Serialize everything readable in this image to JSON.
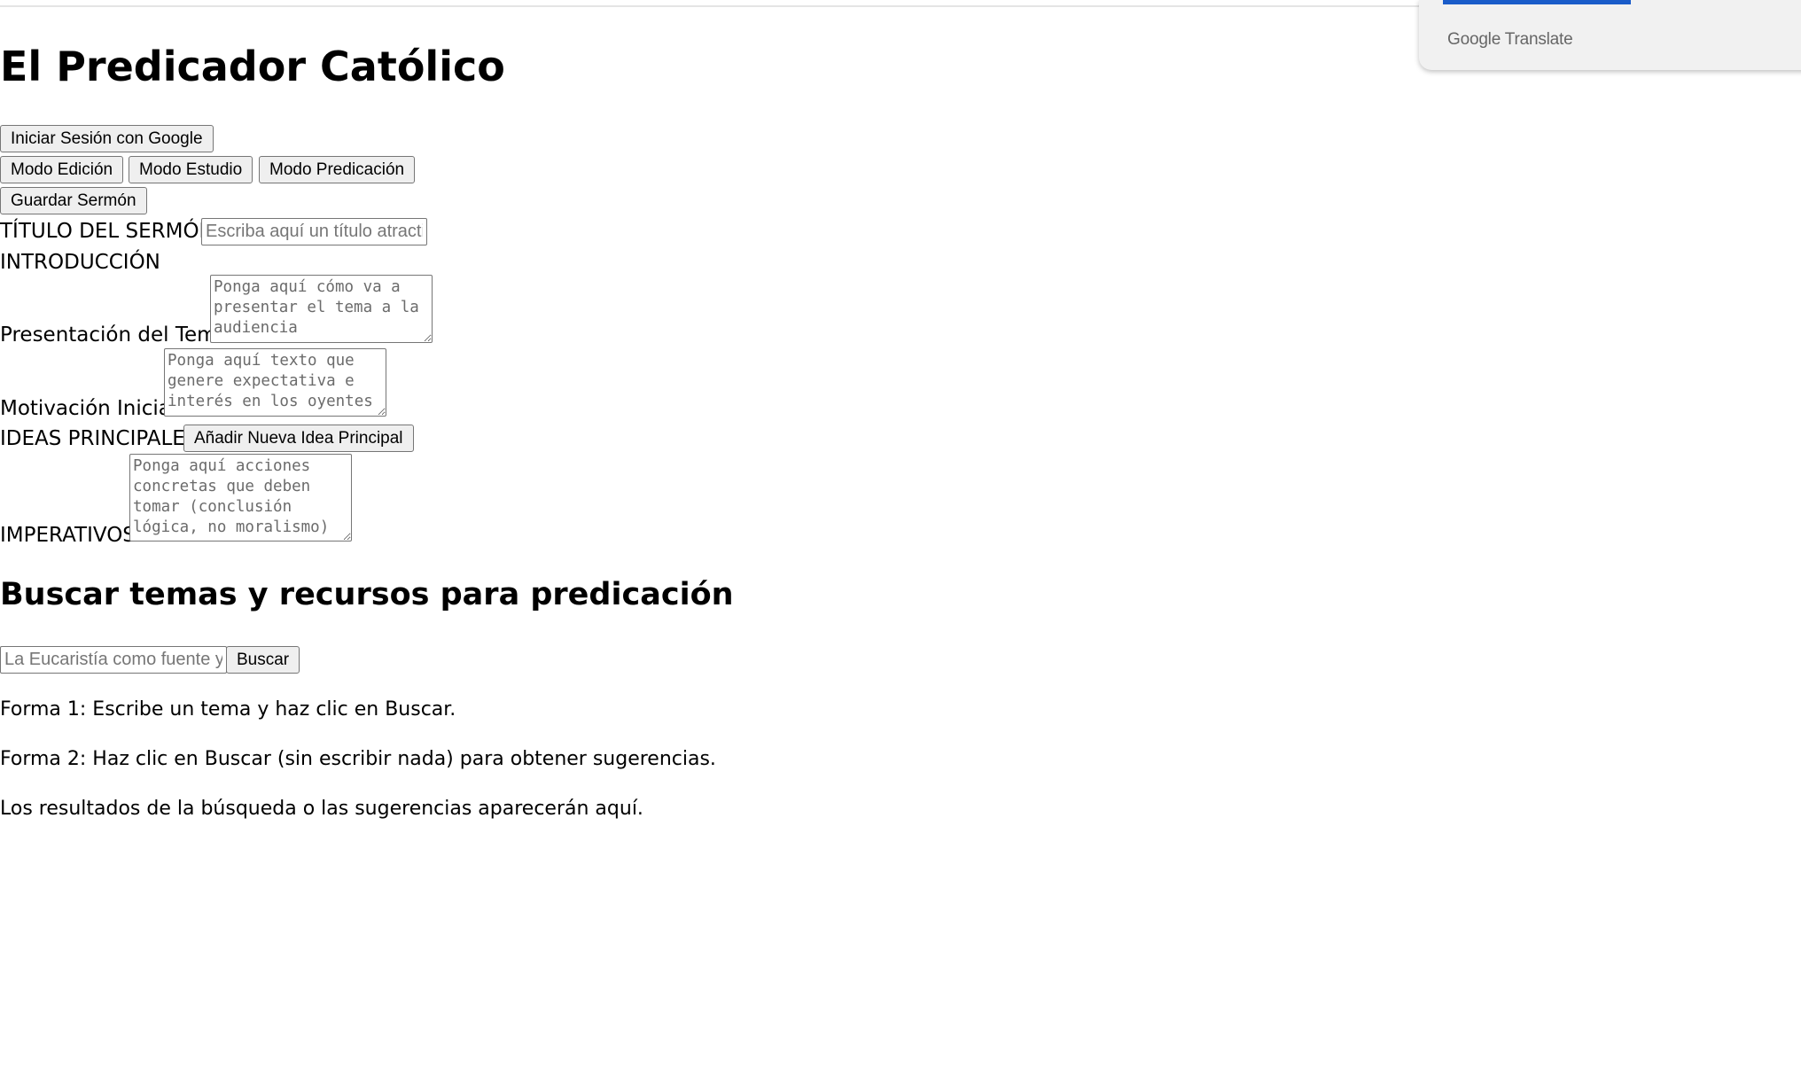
{
  "translate_bar": {
    "logo_text": "Google Translate"
  },
  "app": {
    "title": "El Predicador Católico"
  },
  "buttons": {
    "login": "Iniciar Sesión con Google",
    "modo_edicion": "Modo Edición",
    "modo_estudio": "Modo Estudio",
    "modo_predicacion": "Modo Predicación",
    "guardar": "Guardar Sermón",
    "add_idea": "Añadir Nueva Idea Principal",
    "buscar": "Buscar"
  },
  "form": {
    "titulo_label": "TÍTULO DEL SERMÓN",
    "titulo_placeholder": "Escriba aquí un título atractivo",
    "introduccion_label": "INTRODUCCIÓN",
    "presentacion_label": "Presentación del Tema",
    "presentacion_placeholder": "Ponga aquí cómo va a presentar el tema a la audiencia",
    "motivacion_label": "Motivación Inicial",
    "motivacion_placeholder": "Ponga aquí texto que genere expectativa e interés en los oyentes",
    "ideas_label": "IDEAS PRINCIPALES",
    "imperativos_label": "IMPERATIVOS",
    "imperativos_placeholder": "Ponga aquí acciones concretas que deben tomar (conclusión lógica, no moralismo)"
  },
  "search": {
    "heading": "Buscar temas y recursos para predicación",
    "placeholder": "La Eucaristía como fuente y cumbre",
    "help1": "Forma 1: Escribe un tema y haz clic en Buscar.",
    "help2": "Forma 2: Haz clic en Buscar (sin escribir nada) para obtener sugerencias.",
    "results_text": "Los resultados de la búsqueda o las sugerencias aparecerán aquí."
  }
}
